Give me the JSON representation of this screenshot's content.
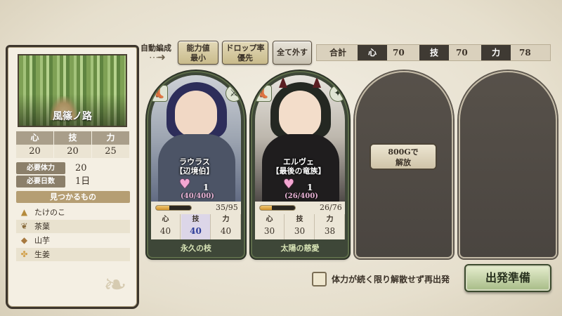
{
  "location": {
    "name": "風篠ノ路",
    "stats": [
      {
        "label": "心",
        "value": "20"
      },
      {
        "label": "技",
        "value": "20"
      },
      {
        "label": "力",
        "value": "25"
      }
    ],
    "requirements": [
      {
        "label": "必要体力",
        "value": "20"
      },
      {
        "label": "必要日数",
        "value": "1日"
      }
    ],
    "found_header": "見つかるもの",
    "items": [
      {
        "icon": "bamboo-shoot-icon",
        "name": "たけのこ"
      },
      {
        "icon": "tea-leaf-icon",
        "name": "茶葉"
      },
      {
        "icon": "yam-icon",
        "name": "山芋"
      },
      {
        "icon": "ginger-icon",
        "name": "生姜"
      }
    ]
  },
  "toolbar": {
    "auto_label": "自動編成",
    "btn_power": "能力値\n最小",
    "btn_drop": "ドロップ率\n優先",
    "btn_clear": "全て外す"
  },
  "totals": {
    "label": "合計",
    "heart_label": "心",
    "heart_value": "70",
    "skill_label": "技",
    "skill_value": "70",
    "power_label": "力",
    "power_value": "78"
  },
  "characters": [
    {
      "name": "ラウラス",
      "title": "【辺境伯】",
      "hearts": "1",
      "affinity": "(40/400)",
      "exp": "35/95",
      "exp_ratio": 0.37,
      "stats": [
        {
          "label": "心",
          "value": "40"
        },
        {
          "label": "技",
          "value": "40"
        },
        {
          "label": "力",
          "value": "40"
        }
      ],
      "highlight_stat": 1,
      "skill": "永久の枝"
    },
    {
      "name": "エルヴェ",
      "title": "【最後の竜族】",
      "hearts": "1",
      "affinity": "(26/400)",
      "exp": "26/76",
      "exp_ratio": 0.34,
      "stats": [
        {
          "label": "心",
          "value": "30"
        },
        {
          "label": "技",
          "value": "30"
        },
        {
          "label": "力",
          "value": "38"
        }
      ],
      "highlight_stat": -1,
      "skill": "太陽の慈愛"
    }
  ],
  "unlock": {
    "line1": "800Gで",
    "line2": "解放"
  },
  "repeat_option": "体力が続く限り解散せず再出発",
  "depart_button": "出発準備"
}
